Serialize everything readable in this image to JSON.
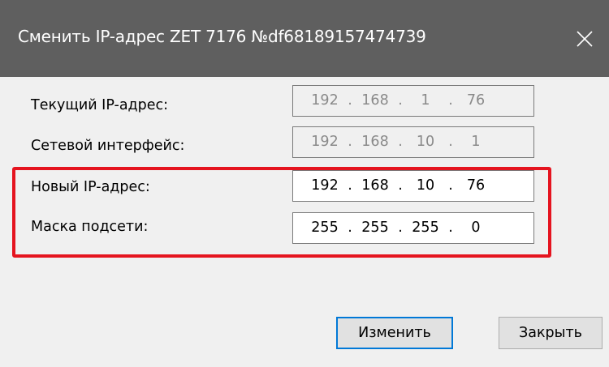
{
  "window": {
    "title": "Сменить IP-адрес ZET 7176 №df68189157474739",
    "close_icon": "close-icon"
  },
  "fields": [
    {
      "label": "Текущий IP-адрес:",
      "octets": [
        "192",
        "168",
        "1",
        "76"
      ],
      "editable": false
    },
    {
      "label": "Сетевой интерфейс:",
      "octets": [
        "192",
        "168",
        "10",
        "1"
      ],
      "editable": false
    },
    {
      "label": "Новый IP-адрес:",
      "octets": [
        "192",
        "168",
        "10",
        "76"
      ],
      "editable": true
    },
    {
      "label": "Маска подсети:",
      "octets": [
        "255",
        "255",
        "255",
        "0"
      ],
      "editable": true
    }
  ],
  "ip_separator": ".",
  "buttons": {
    "change_label": "Изменить",
    "close_label": "Закрыть"
  },
  "colors": {
    "titlebar": "#5f5f5f",
    "highlight": "#e5141f",
    "default_button_border": "#0078d7",
    "dialog_background": "#f0f0f0"
  }
}
